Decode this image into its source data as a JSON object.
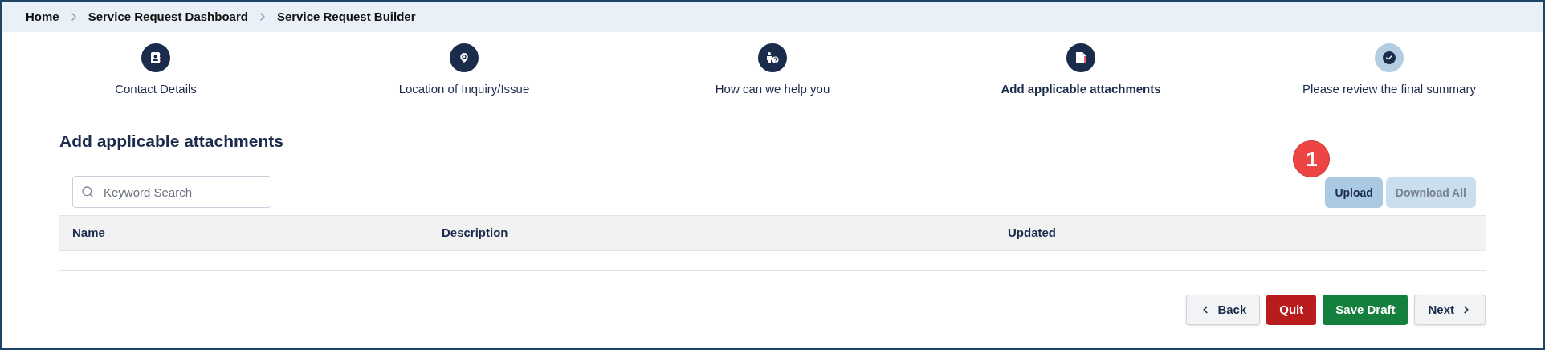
{
  "breadcrumbs": [
    {
      "label": "Home"
    },
    {
      "label": "Service Request Dashboard"
    },
    {
      "label": "Service Request Builder"
    }
  ],
  "steps": [
    {
      "kind": "contact",
      "label": "Contact Details",
      "selected": false,
      "completed": true
    },
    {
      "kind": "location",
      "label": "Location of Inquiry/Issue",
      "selected": false,
      "completed": true
    },
    {
      "kind": "help",
      "label": "How can we help you",
      "selected": false,
      "completed": true
    },
    {
      "kind": "attachment",
      "label": "Add applicable attachments",
      "selected": true,
      "completed": false
    },
    {
      "kind": "review",
      "label": "Please review the final summary",
      "selected": false,
      "completed": false
    }
  ],
  "heading": "Add applicable attachments",
  "search": {
    "placeholder": "Keyword Search"
  },
  "annotation_badge": "1",
  "toolbar_buttons": [
    {
      "label": "Upload",
      "disabled": false
    },
    {
      "label": "Download All",
      "disabled": true
    }
  ],
  "table": {
    "columns": [
      "Name",
      "Description",
      "Updated"
    ]
  },
  "footer_buttons": [
    {
      "kind": "back",
      "label": "Back"
    },
    {
      "kind": "quit",
      "label": "Quit"
    },
    {
      "kind": "save",
      "label": "Save Draft"
    },
    {
      "kind": "next",
      "label": "Next"
    }
  ]
}
